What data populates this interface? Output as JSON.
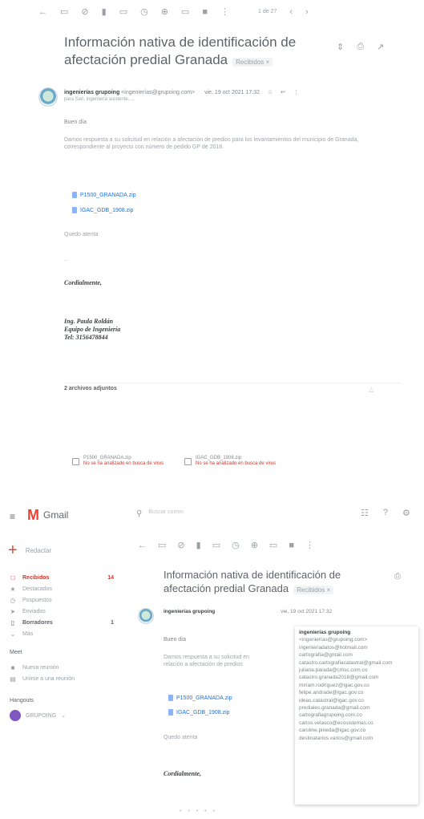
{
  "top": {
    "toolbar_icons": [
      "arrow-back-icon",
      "archive-icon",
      "report-icon",
      "trash-icon",
      "mark-unread-icon",
      "snooze-icon",
      "add-task-icon",
      "move-icon",
      "label-icon",
      "more-icon"
    ],
    "pager": "1 de 27",
    "subject_line1": "Información nativa de identificación de",
    "subject_line2": "afectación predial Granada",
    "label": "Recibidos ×",
    "sender_name": "ingenierías grupoing",
    "sender_email": "<ingenierías@grupoing.com>",
    "date": "vie, 19 oct 2021 17:32",
    "recipients": "para Sari, ingeniería asistente, ...",
    "greeting": "Buen día",
    "body_paragraph": "Damos respuesta a su solicitud en relación a afectación de predios para los levantamientos del municipio de Granada, correspondiente al proyecto con número de pedido GP de 2018.",
    "attachments_inline": [
      "P1500_GRANADA.zip",
      "IGAC_GDB_1908.zip"
    ],
    "closing_short": "Quedo atenta",
    "cordially": "Cordialmente,",
    "signature": [
      "Ing. Paula Roldán",
      "Equipo de Ingeniería",
      "Tel: 3156478844"
    ],
    "attachments_count": "2 archivos adjuntos",
    "attachment_chips": [
      {
        "name": "P1500_GRANADA.zip",
        "status": "No se ha analizado en busca de virus"
      },
      {
        "name": "IGAC_GDB_1908.zip",
        "status": "No se ha analizado en busca de virus"
      }
    ]
  },
  "bottom": {
    "app_name": "Gmail",
    "search_placeholder": "Buscar correo",
    "compose_label": "Redactar",
    "sidebar": [
      {
        "icon": "inbox-icon",
        "label": "Recibidos",
        "count": "14"
      },
      {
        "icon": "star-icon",
        "label": "Destacados",
        "count": ""
      },
      {
        "icon": "snooze-icon",
        "label": "Pospuestos",
        "count": ""
      },
      {
        "icon": "send-icon",
        "label": "Enviados",
        "count": ""
      },
      {
        "icon": "draft-icon",
        "label": "Borradores",
        "count": "1"
      },
      {
        "icon": "expand-icon",
        "label": "Más",
        "count": ""
      }
    ],
    "meet_title": "Meet",
    "meet_items": [
      {
        "icon": "video-icon",
        "label": "Nueva reunión"
      },
      {
        "icon": "keyboard-icon",
        "label": "Unirse a una reunión"
      }
    ],
    "hangouts_title": "Hangouts",
    "hangouts_user": "GRUPOING",
    "subject_line1": "Información nativa de identificación de",
    "subject_line2": "afectación predial Granada",
    "label": "Recibidos ×",
    "sender_name": "ingenierías grupoing",
    "date": "vie, 19 oct 2021 17:32",
    "greeting": "Buen día",
    "body_paragraph": "Damos respuesta a su solicitud en relación a afectación de predios",
    "attachments_inline": [
      "P1500_GRANADA.zip",
      "IGAC_GDB_1908.zip"
    ],
    "closing_short": "Quedo atenta",
    "cordially": "Cordialmente,",
    "recipients_popup": [
      "ingenierías grupoing",
      "<ingenierías@grupoing.com>",
      "ingenieriadatos@hotmail.com",
      "cartografia@gmail.com",
      "catastro.cartografiacatastral@gmail.com",
      "juliana.parada@cmsc.com.co",
      "catastro.granada2018@gmail.com",
      "miriam.rodríguez@igac.gov.co",
      "felipe.andrade@igac.gov.co",
      "ideas.catastral@igac.gov.co",
      "prediales.granada@gmail.com",
      "cartografiagrupoing.com.co",
      "carlos.velasco@ecosistemas.co",
      "caroline.pineda@igac.gov.co",
      "destinatarios.varios@gmail.com"
    ]
  }
}
